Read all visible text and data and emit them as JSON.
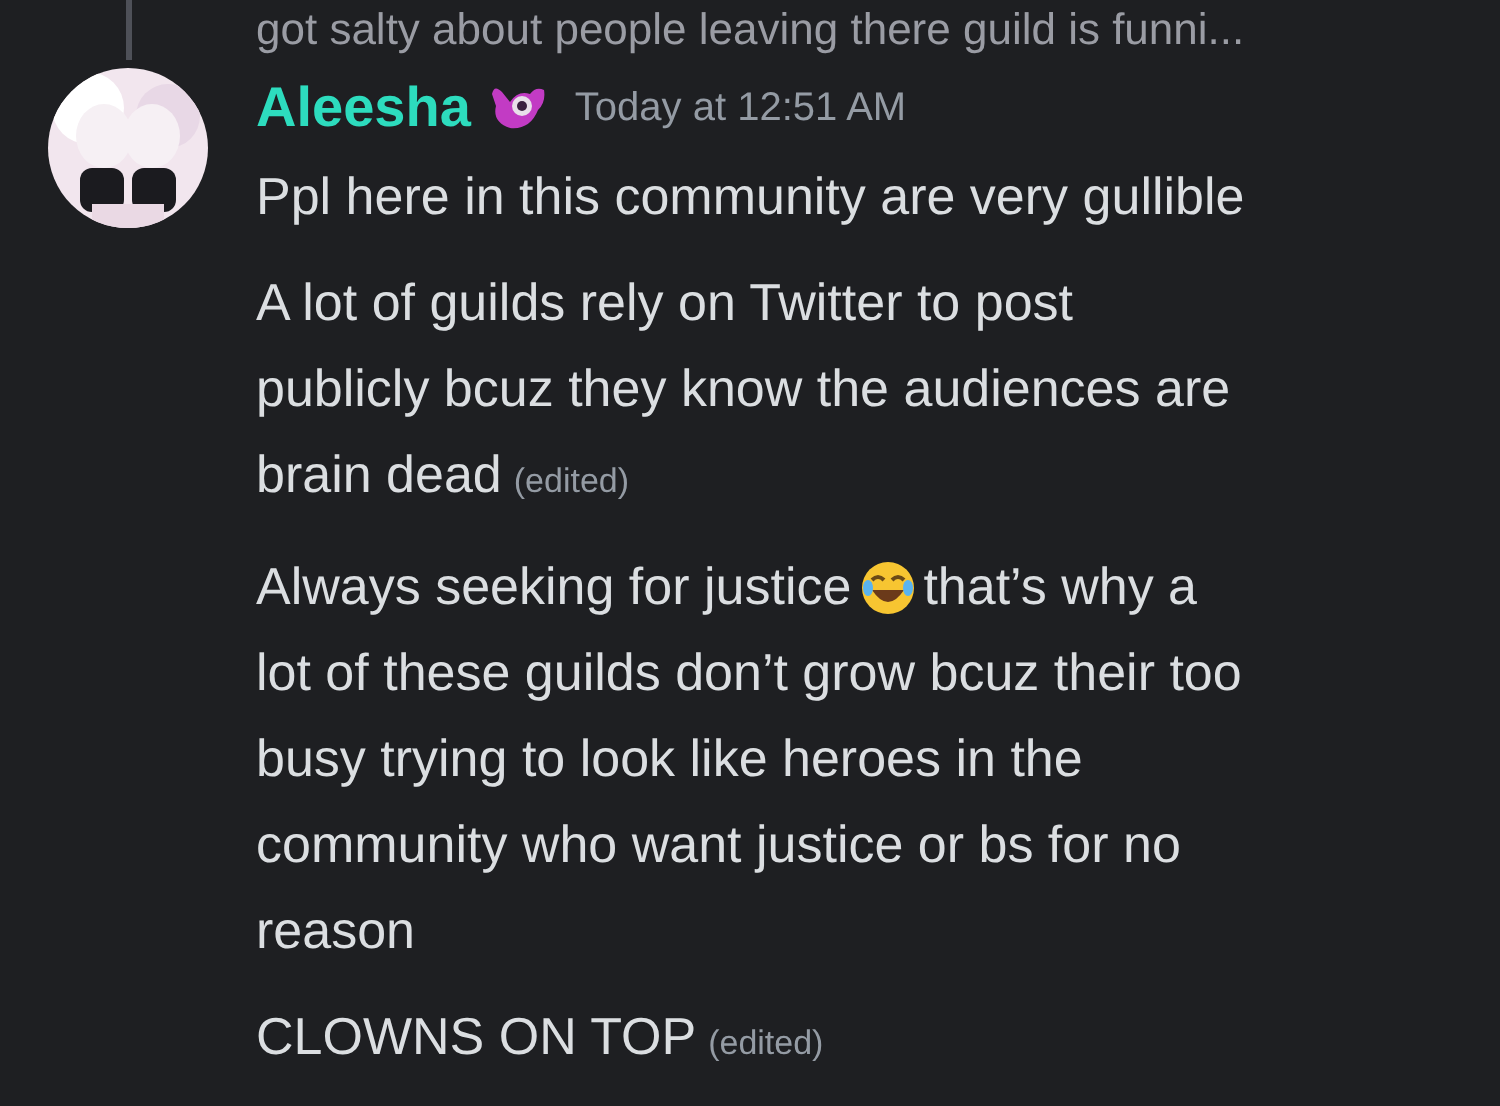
{
  "previous_message_tail": "got salty about people leaving there guild is funni...",
  "message_group": {
    "author": "Aleesha",
    "timestamp": "Today at 12:51 AM",
    "messages": [
      {
        "lines": [
          [
            "Ppl here in this community are very gullible"
          ]
        ],
        "edited": false
      },
      {
        "lines": [
          [
            "A lot of guilds rely on Twitter to post"
          ],
          [
            "publicly bcuz they know the audiences are"
          ],
          [
            "brain dead"
          ]
        ],
        "edited": true,
        "edited_label": "(edited)"
      },
      {
        "lines": [
          [
            "Always seeking for justice",
            "that’s why a"
          ],
          [
            "lot of these guilds don’t grow bcuz their too"
          ],
          [
            "busy trying to look like heroes in the"
          ],
          [
            "community who want justice or bs for no"
          ],
          [
            "reason"
          ]
        ],
        "edited": false
      },
      {
        "lines": [
          [
            "CLOWNS ON TOP"
          ]
        ],
        "edited": true,
        "edited_label": "(edited)"
      }
    ]
  }
}
